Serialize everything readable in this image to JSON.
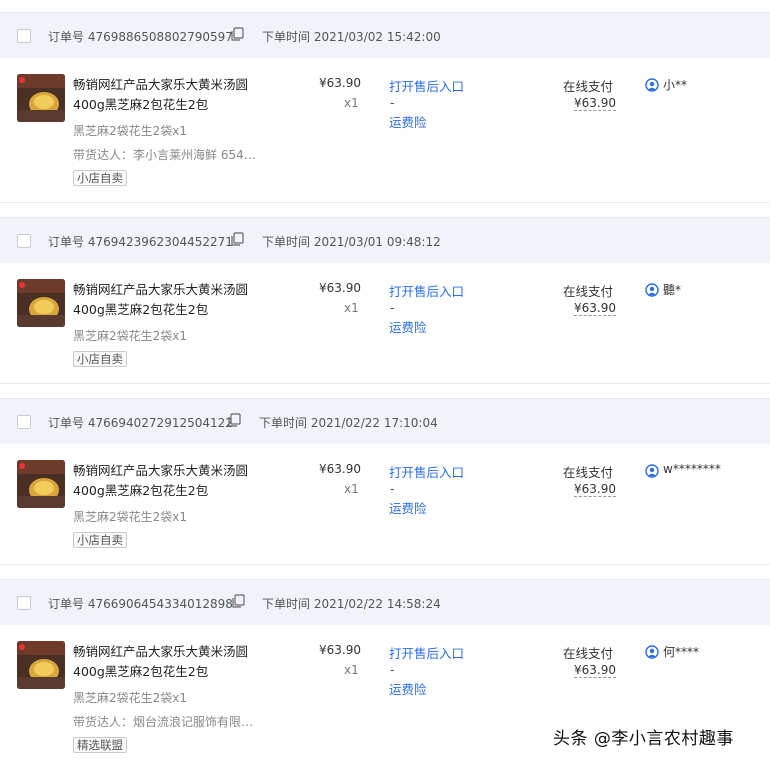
{
  "labels": {
    "order_no": "订单号",
    "order_time": "下单时间",
    "qty": "x1",
    "aftersale": "打开售后入口",
    "dash": "-",
    "insurance": "运费险",
    "pay_method": "在线支付"
  },
  "orders": [
    {
      "order_no": "4769886508802790597",
      "time": "2021/03/02 15:42:00",
      "title": "畅销网红产品大家乐大黄米汤圆400g黑芝麻2包花生2包",
      "spec": "黑芝麻2袋花生2袋x1",
      "promoter": "带货达人：李小言莱州海鲜 654…",
      "tag": "小店自卖",
      "price": "¥63.90",
      "pay_amount": "¥63.90",
      "buyer": "小**"
    },
    {
      "order_no": "4769423962304452271",
      "time": "2021/03/01 09:48:12",
      "title": "畅销网红产品大家乐大黄米汤圆400g黑芝麻2包花生2包",
      "spec": "黑芝麻2袋花生2袋x1",
      "promoter": "",
      "tag": "小店自卖",
      "price": "¥63.90",
      "pay_amount": "¥63.90",
      "buyer": "聽*"
    },
    {
      "order_no": "4766940272912504122",
      "time": "2021/02/22 17:10:04",
      "title": "畅销网红产品大家乐大黄米汤圆400g黑芝麻2包花生2包",
      "spec": "黑芝麻2袋花生2袋x1",
      "promoter": "",
      "tag": "小店自卖",
      "price": "¥63.90",
      "pay_amount": "¥63.90",
      "buyer": "w********"
    },
    {
      "order_no": "4766906454334012898",
      "time": "2021/02/22 14:58:24",
      "title": "畅销网红产品大家乐大黄米汤圆400g黑芝麻2包花生2包",
      "spec": "黑芝麻2袋花生2袋x1",
      "promoter": "带货达人：烟台流浪记服饰有限…",
      "tag": "精选联盟",
      "price": "¥63.90",
      "pay_amount": "¥63.90",
      "buyer": "何****"
    }
  ],
  "watermark": "头条 @李小言农村趣事",
  "colors": {
    "header_bg": "#f0f3f9",
    "link": "#2b6de5",
    "buyer_icon": "#2b6de5"
  }
}
